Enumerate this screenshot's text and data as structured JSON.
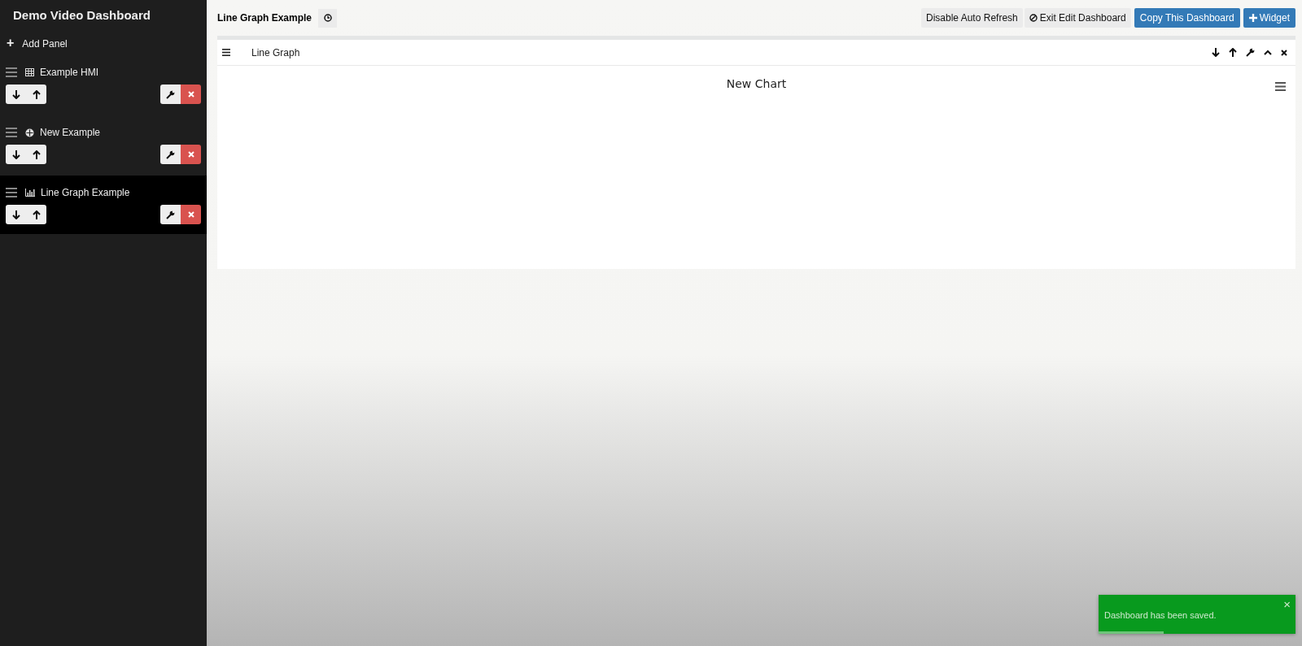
{
  "sidebar": {
    "title": "Demo Video Dashboard",
    "add_panel": {
      "icon": "+",
      "label": "Add Panel"
    },
    "panels": [
      {
        "name": "Example HMI",
        "kind": "table",
        "selected": false
      },
      {
        "name": "New Example",
        "kind": "target",
        "selected": false
      },
      {
        "name": "Line Graph Example",
        "kind": "chart",
        "selected": true
      }
    ]
  },
  "toolbar": {
    "title": "Line Graph Example",
    "buttons": [
      {
        "label": "Disable Auto Refresh",
        "kind": "plain"
      },
      {
        "label": "Exit Edit Dashboard",
        "kind": "exit"
      },
      {
        "label": "Copy This Dashboard",
        "kind": "primary"
      },
      {
        "label": "Widget",
        "kind": "add"
      }
    ]
  },
  "widget": {
    "title": "Line Graph",
    "chart_title": "New Chart"
  },
  "toast": {
    "message": "Dashboard has been saved.",
    "close": "×",
    "level": 0.33
  }
}
